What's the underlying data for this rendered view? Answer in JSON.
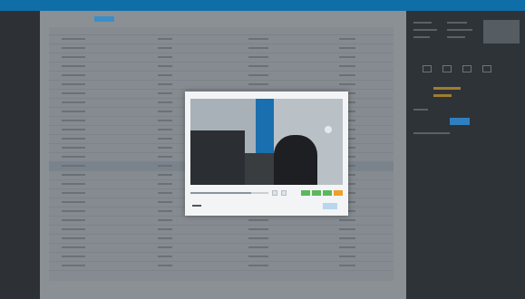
{
  "app": {
    "title": "",
    "header_right": ""
  },
  "sidebar": {
    "items": [
      "",
      "",
      ""
    ],
    "footer": ""
  },
  "table": {
    "columns": [
      "",
      "",
      "",
      ""
    ],
    "row_count": 26,
    "selected_row_index": 14
  },
  "modal": {
    "video_progress": 0.78,
    "footer_label": "",
    "ok_label": ""
  },
  "colors": {
    "topbar": "#0f6ea8",
    "accent_blue": "#2f7fbf",
    "action_green": "#5cb85c",
    "action_orange": "#f0a02a",
    "highlight_gold": "#a27c2f"
  },
  "icons": [
    "camera-icon",
    "play-icon",
    "settings-icon",
    "close-icon"
  ]
}
